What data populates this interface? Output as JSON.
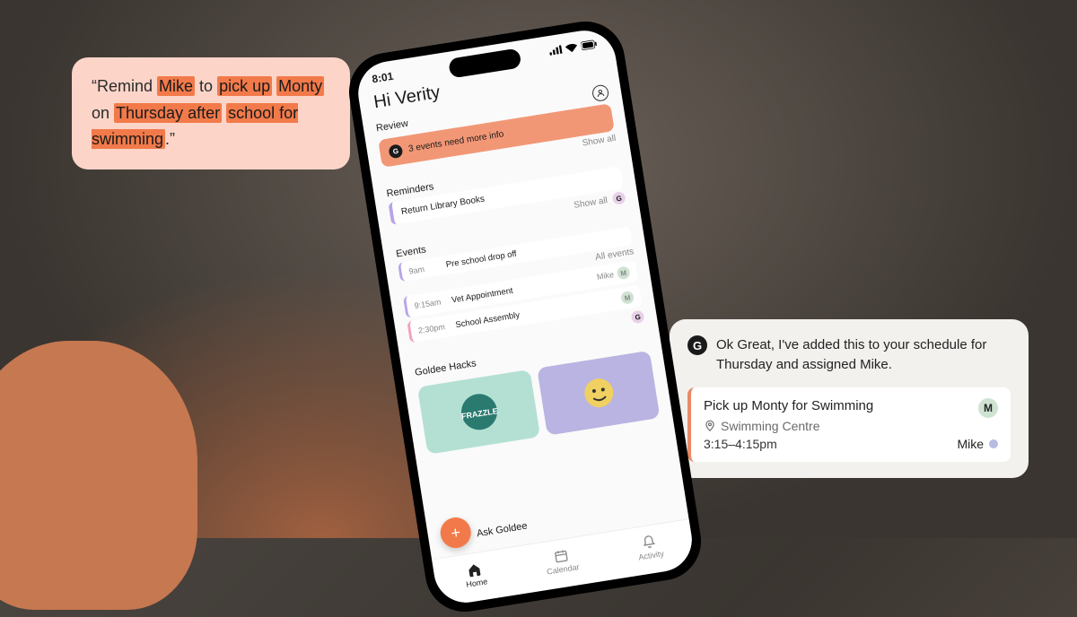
{
  "quote": {
    "pre": "“Remind ",
    "hl1": "Mike",
    "mid1": " to ",
    "hl2": "pick up",
    "mid2": " ",
    "hl3": "Monty",
    "mid3": " on ",
    "hl4": "Thursday after",
    "mid4": " ",
    "hl5": "school for swimming",
    "post": ".”"
  },
  "response": {
    "text": "Ok Great, I've added this to your schedule for Thursday and assigned Mike.",
    "event": {
      "title": "Pick up Monty for Swimming",
      "location": "Swimming Centre",
      "time": "3:15–4:15pm",
      "assignee": "Mike",
      "badge": "M"
    }
  },
  "phone": {
    "time": "8:01",
    "greeting": "Hi Verity",
    "review": {
      "title": "Review",
      "text": "3 events need more info",
      "link": "Show all"
    },
    "reminders": {
      "title": "Reminders",
      "item": "Return Library Books",
      "link": "Show all",
      "badge": "G"
    },
    "events": {
      "title": "Events",
      "link": "All events",
      "items": [
        {
          "time": "9am",
          "title": "Pre school drop off",
          "who": "",
          "badge": ""
        },
        {
          "time": "9:15am",
          "title": "Vet Appointment",
          "who": "Mike",
          "badge": "M"
        },
        {
          "time": "2:30pm",
          "title": "School Assembly",
          "who": "",
          "badge": "M"
        }
      ],
      "footer_badge": "G"
    },
    "hacks": {
      "title": "Goldee Hacks"
    },
    "fab": "+",
    "ask": "Ask Goldee",
    "tabs": [
      {
        "label": "Home"
      },
      {
        "label": "Calendar"
      },
      {
        "label": "Activity"
      }
    ]
  },
  "glyph": {
    "g": "G"
  }
}
